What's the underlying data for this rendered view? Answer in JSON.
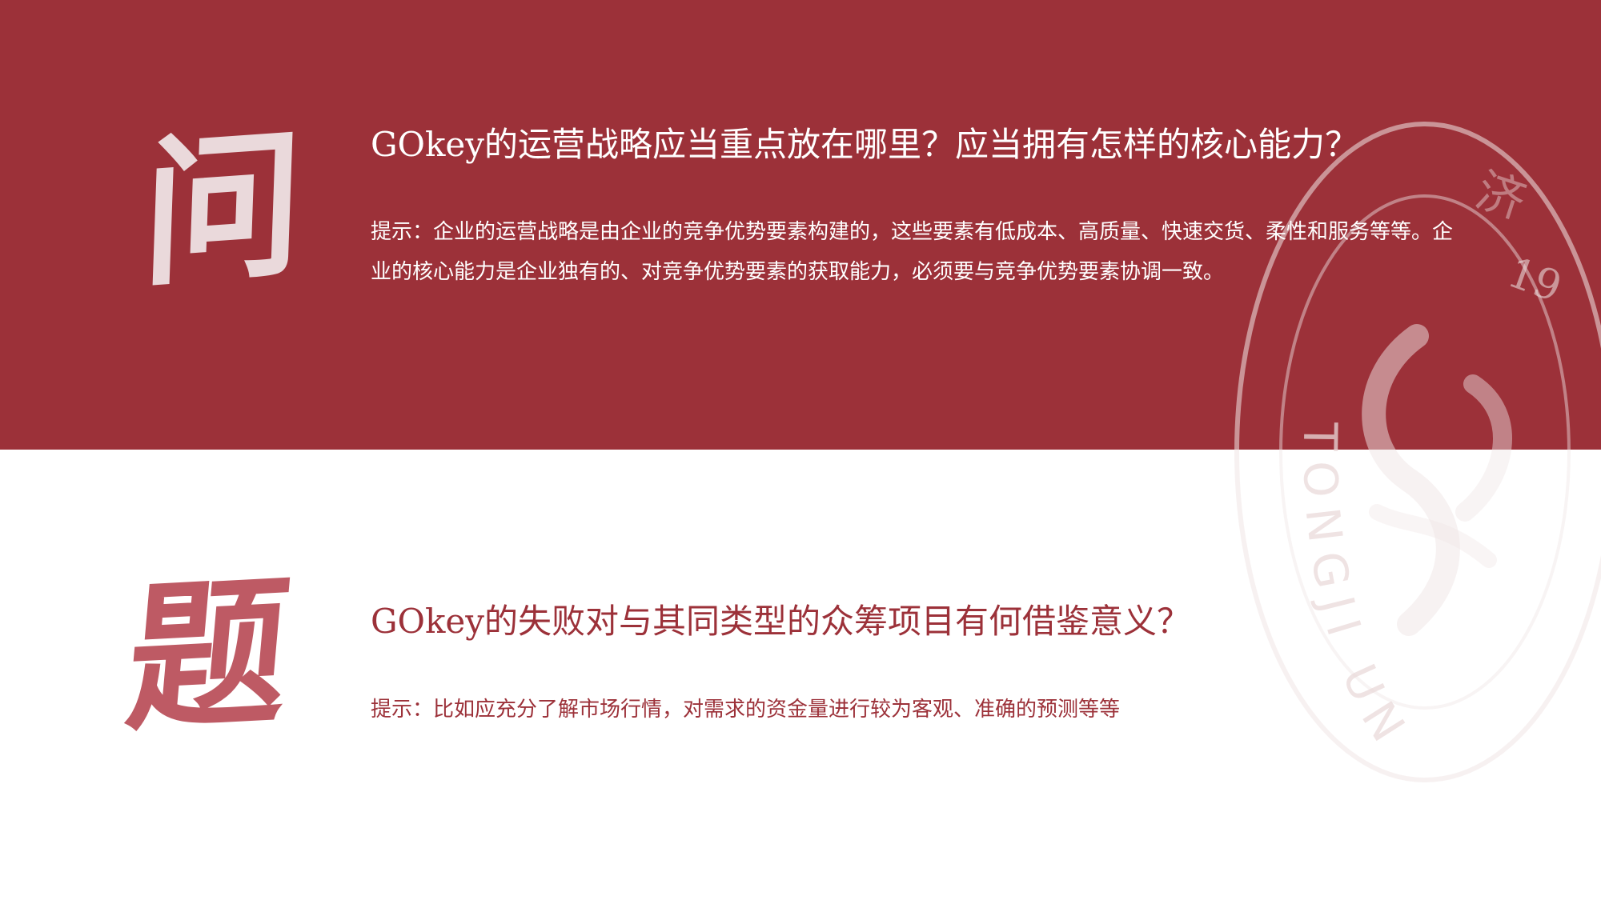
{
  "decor": {
    "calligraphy_top": "问",
    "calligraphy_bottom": "题"
  },
  "questions": [
    {
      "title": "GOkey的运营战略应当重点放在哪里？应当拥有怎样的核心能力？",
      "hint": "提示：企业的运营战略是由企业的竞争优势要素构建的，这些要素有低成本、高质量、快速交货、柔性和服务等等。企业的核心能力是企业独有的、对竞争优势要素的获取能力，必须要与竞争优势要素协调一致。"
    },
    {
      "title": "GOkey的失败对与其同类型的众筹项目有何借鉴意义？",
      "hint": "提示：比如应充分了解市场行情，对需求的资金量进行较为客观、准确的预测等等"
    }
  ],
  "watermark": {
    "ring_text": "TONGJI UN",
    "year_fragment": "19",
    "top_glyph": "济"
  },
  "colors": {
    "band": "#9c3139",
    "text_light": "#ffffff",
    "calligraphy_light": "#ead9db",
    "calligraphy_dark": "#be5a64",
    "accent": "#9c3139"
  }
}
